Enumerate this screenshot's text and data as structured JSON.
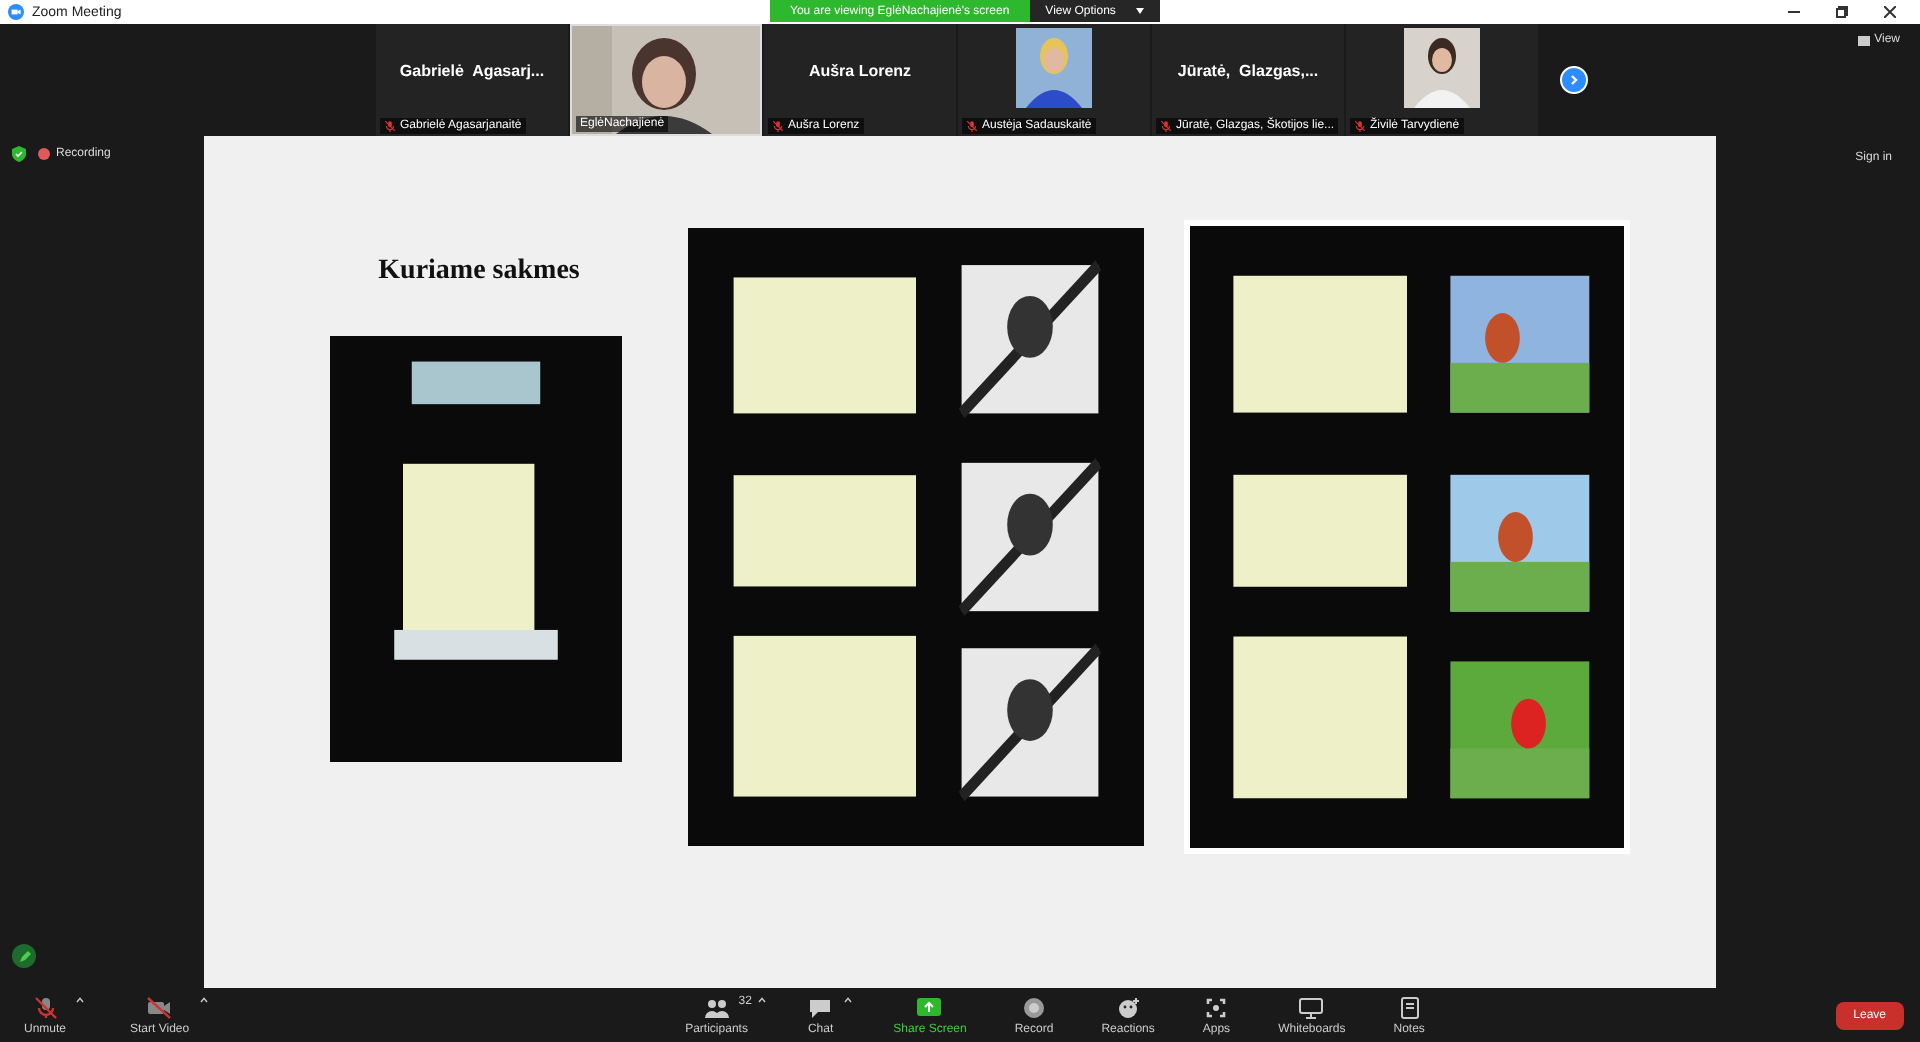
{
  "window": {
    "title": "Zoom Meeting"
  },
  "share_banner": {
    "text": "You are viewing EglėNachajienė's screen",
    "button": "View Options"
  },
  "participants": [
    {
      "display_name": "Gabrielė  Agasarj...",
      "name": "Gabrielė Agasarjanaitė",
      "muted": true,
      "kind": "name",
      "active": false
    },
    {
      "name": "EglėNachajienė",
      "muted": false,
      "kind": "video",
      "active": true
    },
    {
      "display_name": "Aušra Lorenz",
      "name": "Aušra Lorenz",
      "muted": true,
      "kind": "name",
      "active": false
    },
    {
      "name": "Austėja Sadauskaitė",
      "muted": true,
      "active": false
    },
    {
      "display_name": "Jūratė,  Glazgas,...",
      "name": "Jūratė, Glazgas, Škotijos lie...",
      "muted": true,
      "kind": "name",
      "active": false
    },
    {
      "name": "Živilė Tarvydienė",
      "muted": true,
      "active": false
    }
  ],
  "view_button": "View",
  "recording": "Recording",
  "sign_in": "Sign in",
  "slide": {
    "title": "Kuriame sakmes"
  },
  "toolbar_left": [
    {
      "label": "Unmute",
      "kind": "mic",
      "caret": true
    },
    {
      "label": "Start Video",
      "kind": "video",
      "caret": true
    }
  ],
  "toolbar_center": [
    {
      "label": "Participants",
      "kind": "people",
      "caret": true,
      "count": "32"
    },
    {
      "label": "Chat",
      "kind": "chat",
      "caret": true
    },
    {
      "label": "Share Screen",
      "kind": "share",
      "caret": false
    },
    {
      "label": "Record",
      "kind": "record",
      "caret": false
    },
    {
      "label": "Reactions",
      "kind": "reactions",
      "caret": false
    },
    {
      "label": "Apps",
      "kind": "apps",
      "caret": false
    },
    {
      "label": "Whiteboards",
      "kind": "whiteboard",
      "caret": false
    },
    {
      "label": "Notes",
      "kind": "notes",
      "caret": false
    }
  ],
  "leave_button": "Leave"
}
